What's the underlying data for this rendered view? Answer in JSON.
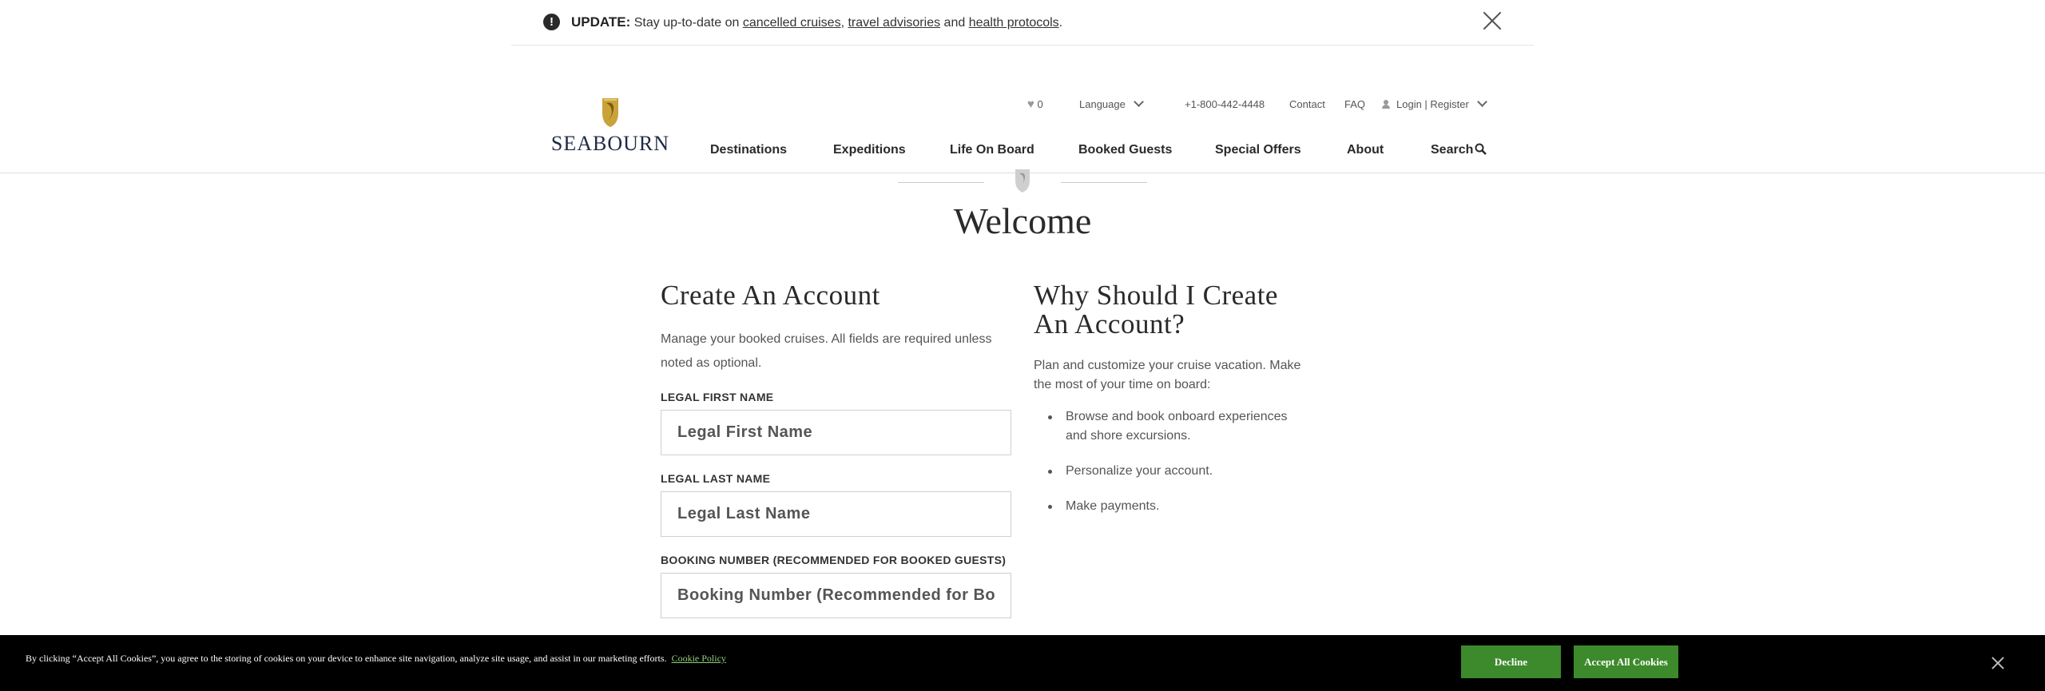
{
  "update_banner": {
    "label": "UPDATE:",
    "text_before": "Stay up-to-date on",
    "link_cruises": "cancelled cruises",
    "sep1": ",",
    "link_advisories": "travel advisories",
    "sep2": "and",
    "link_health": "health protocols",
    "end": ".",
    "icon": "exclamation-circle-icon"
  },
  "header": {
    "logo_text": "SEABOURN",
    "favorites_count": "0",
    "language_label": "Language",
    "phone": "+1-800-442-4448",
    "contact": "Contact",
    "faq": "FAQ",
    "login": "Login | Register",
    "nav": {
      "destinations": "Destinations",
      "expeditions": "Expeditions",
      "life_on_board": "Life On Board",
      "booked_guests": "Booked Guests",
      "special_offers": "Special Offers",
      "about": "About",
      "search": "Search"
    }
  },
  "welcome": {
    "title": "Welcome"
  },
  "form": {
    "title": "Create An Account",
    "intro": "Manage your booked cruises. All fields are required unless noted as optional.",
    "first_name_label": "LEGAL FIRST NAME",
    "first_name_placeholder": "Legal First Name",
    "last_name_label": "LEGAL LAST NAME",
    "last_name_placeholder": "Legal Last Name",
    "booking_label": "BOOKING NUMBER (RECOMMENDED FOR BOOKED GUESTS)",
    "booking_placeholder": "Booking Number (Recommended for Booked Guests)"
  },
  "why": {
    "title": "Why Should I Create An Account?",
    "intro": "Plan and customize your cruise vacation. Make the most of your time on board:",
    "items": [
      "Browse and book onboard experiences and shore excursions.",
      "Personalize your account.",
      "Make payments."
    ]
  },
  "cookie": {
    "text": "By clicking “Accept All Cookies”, you agree to the storing of cookies on your device to enhance site navigation, analyze site usage, and assist in our marketing efforts.",
    "policy_link": "Cookie Policy",
    "decline": "Decline",
    "accept": "Accept All Cookies"
  },
  "colors": {
    "accent_gold": "#c9a23a",
    "brand_navy": "#1f2a44",
    "cookie_button_green": "#3c8a2b",
    "cookie_link_green": "#8fd07b"
  }
}
